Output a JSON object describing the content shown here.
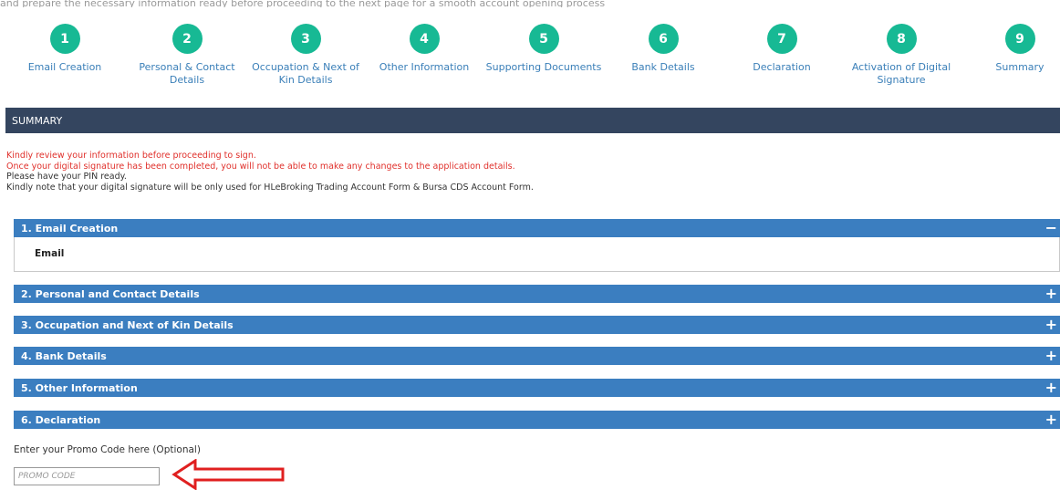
{
  "header": {
    "cropped_text": "and prepare the necessary information ready before proceeding to the next page for a smooth account opening process"
  },
  "steps": [
    {
      "number": "1",
      "label": "Email Creation"
    },
    {
      "number": "2",
      "label": "Personal & Contact Details"
    },
    {
      "number": "3",
      "label": "Occupation & Next of Kin Details"
    },
    {
      "number": "4",
      "label": "Other Information"
    },
    {
      "number": "5",
      "label": "Supporting Documents"
    },
    {
      "number": "6",
      "label": "Bank Details"
    },
    {
      "number": "7",
      "label": "Declaration"
    },
    {
      "number": "8",
      "label": "Activation of Digital Signature"
    },
    {
      "number": "9",
      "label": "Summary"
    }
  ],
  "summary_bar": {
    "title": "SUMMARY"
  },
  "notes": {
    "line1": "Kindly review your information before proceeding to sign.",
    "line2": "Once your digital signature has been completed, you will not be able to make any changes to the application details.",
    "line3": "Please have your PIN ready.",
    "line4": "Kindly note that your digital signature will be only used for HLeBroking Trading Account Form & Bursa CDS Account Form."
  },
  "sections": [
    {
      "title": "1. Email Creation",
      "toggle": "−",
      "expanded": true,
      "fields": [
        "Email"
      ]
    },
    {
      "title": "2. Personal and Contact Details",
      "toggle": "+"
    },
    {
      "title": "3. Occupation and Next of Kin Details",
      "toggle": "+"
    },
    {
      "title": "4. Bank Details",
      "toggle": "+"
    },
    {
      "title": "5. Other Information",
      "toggle": "+"
    },
    {
      "title": "6. Declaration",
      "toggle": "+"
    }
  ],
  "promo": {
    "label": "Enter your Promo Code here (Optional)",
    "placeholder": "PROMO CODE",
    "value": ""
  },
  "colors": {
    "step_circle": "#17b994",
    "step_label": "#3a7fb8",
    "summary_bar": "#34455f",
    "accordion": "#3b7ec0",
    "warning_text": "#e0302b",
    "arrow": "#e02020"
  }
}
